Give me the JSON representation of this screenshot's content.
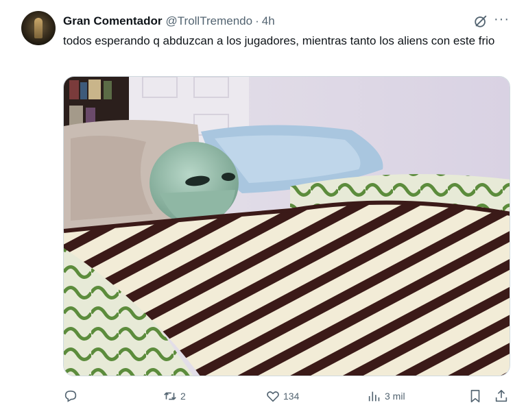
{
  "tweet": {
    "display_name": "Gran Comentador",
    "handle": "@TrollTremendo",
    "separator": "·",
    "time": "4h",
    "text": "todos esperando q abduzcan a los jugadores, mientras tanto los aliens con este frio"
  },
  "media": {
    "description_icon": "photo"
  },
  "actions": {
    "reply_count": "",
    "retweet_count": "2",
    "like_count": "134",
    "views_count": "3 mil"
  },
  "icons": {
    "grok": "grok-icon",
    "more": "more-icon",
    "reply": "reply-icon",
    "retweet": "retweet-icon",
    "like": "heart-icon",
    "views": "views-icon",
    "bookmark": "bookmark-icon",
    "share": "share-icon"
  },
  "colors": {
    "text": "#0f1419",
    "secondary": "#536471",
    "border": "#cfd9de"
  }
}
